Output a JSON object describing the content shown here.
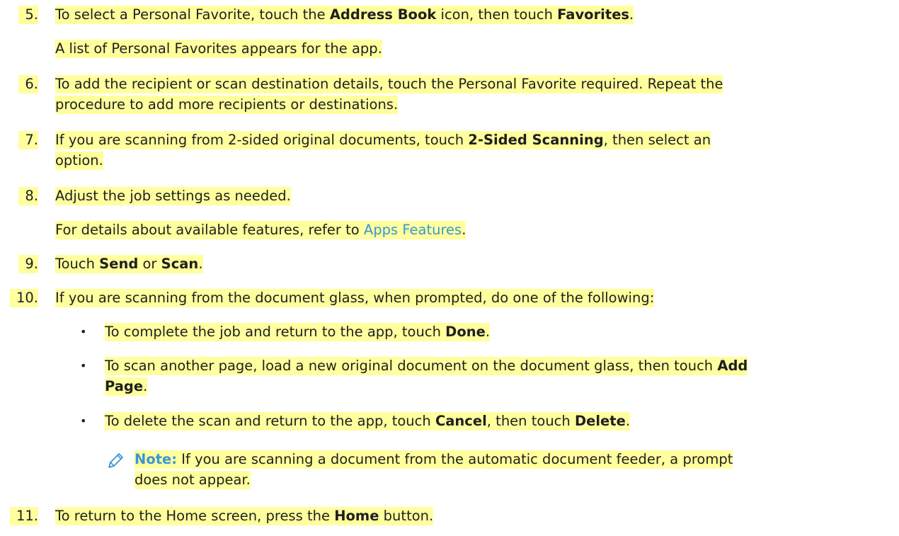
{
  "steps": {
    "s5": {
      "num": "5.",
      "pre": "To select a Personal Favorite, touch the ",
      "b1": "Address Book",
      "mid": " icon, then touch ",
      "b2": "Favorites",
      "post": "."
    },
    "s5_sub": "A list of Personal Favorites appears for the app.",
    "s6": {
      "num": "6.",
      "line1": "To add the recipient or scan destination details, touch the Personal Favorite required. Repeat the",
      "line2": "procedure to add more recipients or destinations."
    },
    "s7": {
      "num": "7.",
      "pre": "If you are scanning from 2-sided original documents, touch ",
      "b1": "2-Sided Scanning",
      "post": ", then select an",
      "line2": "option."
    },
    "s8": {
      "num": "8.",
      "text": "Adjust the job settings as needed."
    },
    "s8_sub": {
      "pre": "For details about available features, refer to ",
      "link": "Apps Features",
      "post": "."
    },
    "s9": {
      "num": "9.",
      "pre": "Touch ",
      "b1": "Send",
      "mid": " or ",
      "b2": "Scan",
      "post": "."
    },
    "s10": {
      "num": "10.",
      "text": "If you are scanning from the document glass, when prompted, do one of the following:"
    },
    "bullets": {
      "b1": {
        "pre": "To complete the job and return to the app, touch ",
        "b1": "Done",
        "post": "."
      },
      "b2": {
        "pre": "To scan another page, load a new original document on the document glass, then touch ",
        "b1": "Add",
        "line2b": "Page",
        "post": "."
      },
      "b3": {
        "pre": "To delete the scan and return to the app, touch ",
        "b1": "Cancel",
        "mid": ", then touch ",
        "b2": "Delete",
        "post": "."
      }
    },
    "note": {
      "label": "Note:",
      "line1": " If you are scanning a document from the automatic document feeder, a prompt",
      "line2": "does not appear."
    },
    "s11": {
      "num": "11.",
      "pre": "To return to the Home screen, press the ",
      "b1": "Home",
      "post": " button."
    }
  },
  "bullet_glyph": "•",
  "colors": {
    "highlight": "#ffff9e",
    "link": "#3a96d6",
    "text": "#1f1f1f"
  },
  "icons": {
    "note": "pencil-icon"
  }
}
